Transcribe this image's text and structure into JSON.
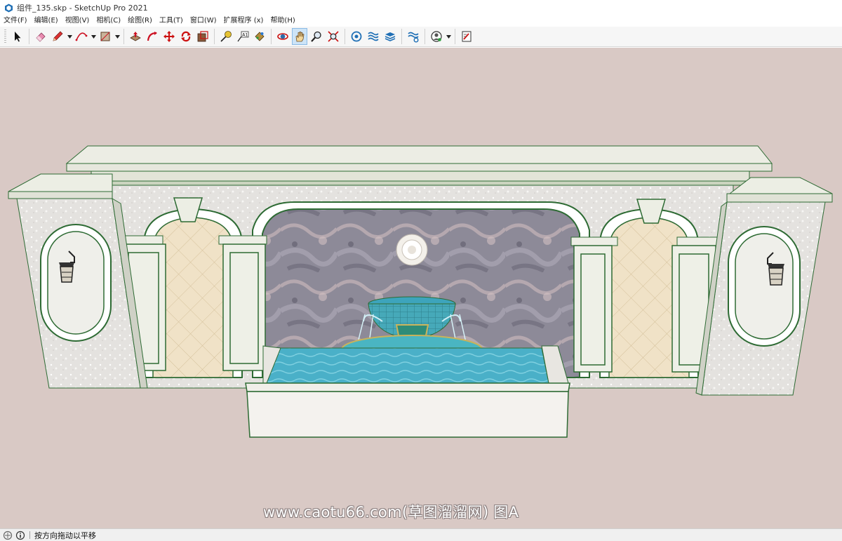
{
  "window": {
    "title": "组件_135.skp - SketchUp Pro 2021"
  },
  "menu": [
    {
      "label": "文件(F)"
    },
    {
      "label": "编辑(E)"
    },
    {
      "label": "视图(V)"
    },
    {
      "label": "相机(C)"
    },
    {
      "label": "绘图(R)"
    },
    {
      "label": "工具(T)"
    },
    {
      "label": "窗口(W)"
    },
    {
      "label": "扩展程序 (x)"
    },
    {
      "label": "帮助(H)"
    }
  ],
  "toolbar": {
    "tools": [
      "select-icon",
      "eraser-icon",
      "pencil-icon",
      "arc-icon",
      "rectangle-icon",
      "push-pull-icon",
      "follow-me-icon",
      "move-icon",
      "rotate-icon",
      "scale-icon",
      "tape-measure-icon",
      "text-icon",
      "paint-bucket-icon",
      "orbit-icon",
      "pan-icon",
      "zoom-icon",
      "zoom-extents-icon",
      "warehouse-icon",
      "extension-warehouse-icon",
      "layout-icon",
      "extension-manager-icon",
      "profile-icon",
      "send-to-layout-icon"
    ],
    "active_tool": "pan-icon"
  },
  "viewport": {
    "background": "#d9c9c5"
  },
  "watermark": {
    "text": "www.caotu66.com(草图溜溜网) 图A"
  },
  "status": {
    "message": "按方向拖动以平移"
  }
}
